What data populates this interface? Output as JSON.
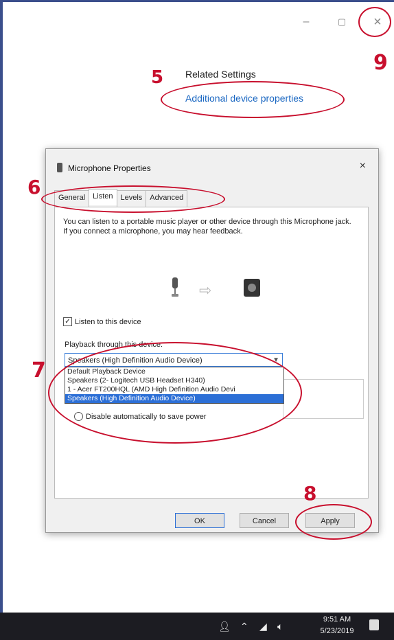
{
  "window_controls": {
    "minimize": "–",
    "maximize": "▢",
    "close": "×"
  },
  "related": {
    "title": "Related Settings",
    "link": "Additional device properties"
  },
  "annotations": [
    "5",
    "6",
    "7",
    "8",
    "9"
  ],
  "dialog": {
    "title": "Microphone Properties",
    "close": "×",
    "tabs": [
      "General",
      "Listen",
      "Levels",
      "Advanced"
    ],
    "active_tab": "Listen",
    "description": "You can listen to a portable music player or other device through this Microphone jack.  If you connect a microphone, you may hear feedback.",
    "listen_checkbox": {
      "label": "Listen to this device",
      "checked": true,
      "mark": "✓"
    },
    "playback_label": "Playback through this device:",
    "playback_selected": "Speakers (High Definition Audio Device)",
    "playback_options": [
      "Default Playback Device",
      "Speakers (2- Logitech USB Headset H340)",
      "1 - Acer FT200HQL (AMD High Definition Audio Devi",
      "Speakers (High Definition Audio Device)"
    ],
    "power_radio_label": "Disable automatically to save power",
    "buttons": {
      "ok": "OK",
      "cancel": "Cancel",
      "apply": "Apply"
    }
  },
  "taskbar": {
    "time": "9:51 AM",
    "date": "5/23/2019"
  },
  "icons": [
    "people-icon",
    "chevron-up-icon",
    "network-icon",
    "volume-icon",
    "notification-icon",
    "microphone-icon",
    "arrow-right-icon",
    "speaker-icon"
  ],
  "colors": {
    "annotation": "#c8102e",
    "link": "#1a67c2",
    "selection": "#2c6fd6",
    "taskbar": "#1c1c22"
  }
}
